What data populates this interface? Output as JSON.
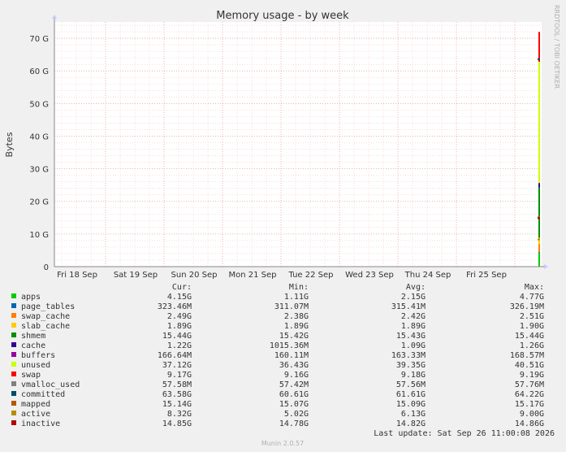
{
  "chart_data": {
    "type": "area",
    "title": "Memory usage - by week",
    "ylabel": "Bytes",
    "xlabel": "",
    "ylim": [
      0,
      75
    ],
    "yunit": "G",
    "y_ticks": [
      "0",
      "10 G",
      "20 G",
      "30 G",
      "40 G",
      "50 G",
      "60 G",
      "70 G"
    ],
    "x_ticks": [
      "Fri 18 Sep",
      "Sat 19 Sep",
      "Sun 20 Sep",
      "Mon 21 Sep",
      "Tue 22 Sep",
      "Wed 23 Sep",
      "Thu 24 Sep",
      "Fri 25 Sep"
    ],
    "grid": true,
    "columns": [
      "Cur:",
      "Min:",
      "Avg:",
      "Max:"
    ],
    "series": [
      {
        "name": "apps",
        "color": "#00cc00",
        "cur": "4.15G",
        "min": "1.11G",
        "avg": "2.15G",
        "max": "4.77G"
      },
      {
        "name": "page_tables",
        "color": "#0066b3",
        "cur": "323.46M",
        "min": "311.07M",
        "avg": "315.41M",
        "max": "326.19M"
      },
      {
        "name": "swap_cache",
        "color": "#ff8000",
        "cur": "2.49G",
        "min": "2.38G",
        "avg": "2.42G",
        "max": "2.51G"
      },
      {
        "name": "slab_cache",
        "color": "#ffcc00",
        "cur": "1.89G",
        "min": "1.89G",
        "avg": "1.89G",
        "max": "1.90G"
      },
      {
        "name": "shmem",
        "color": "#008f00",
        "cur": "15.44G",
        "min": "15.42G",
        "avg": "15.43G",
        "max": "15.44G"
      },
      {
        "name": "cache",
        "color": "#330099",
        "cur": "1.22G",
        "min": "1015.36M",
        "avg": "1.09G",
        "max": "1.26G"
      },
      {
        "name": "buffers",
        "color": "#990099",
        "cur": "166.64M",
        "min": "160.11M",
        "avg": "163.33M",
        "max": "168.57M"
      },
      {
        "name": "unused",
        "color": "#ccff00",
        "cur": "37.12G",
        "min": "36.43G",
        "avg": "39.35G",
        "max": "40.51G"
      },
      {
        "name": "swap",
        "color": "#ff0000",
        "cur": "9.17G",
        "min": "9.16G",
        "avg": "9.18G",
        "max": "9.19G"
      },
      {
        "name": "vmalloc_used",
        "color": "#808080",
        "cur": "57.58M",
        "min": "57.42M",
        "avg": "57.56M",
        "max": "57.76M"
      },
      {
        "name": "committed",
        "color": "#004d66",
        "cur": "63.58G",
        "min": "60.61G",
        "avg": "61.61G",
        "max": "64.22G"
      },
      {
        "name": "mapped",
        "color": "#b35a00",
        "cur": "15.14G",
        "min": "15.07G",
        "avg": "15.09G",
        "max": "15.17G"
      },
      {
        "name": "active",
        "color": "#b38f00",
        "cur": "8.32G",
        "min": "5.02G",
        "avg": "6.13G",
        "max": "9.00G"
      },
      {
        "name": "inactive",
        "color": "#b30000",
        "cur": "14.85G",
        "min": "14.78G",
        "avg": "14.82G",
        "max": "14.86G"
      }
    ],
    "stack_order": [
      "apps",
      "page_tables",
      "swap_cache",
      "slab_cache",
      "shmem",
      "cache",
      "buffers",
      "unused",
      "swap"
    ],
    "line_series": [
      "committed",
      "mapped",
      "active",
      "inactive"
    ],
    "last_update": "Last update: Sat Sep 26 11:00:08 2026"
  },
  "watermark": "RRDTOOL / TOBI OETIKER",
  "footer": "Munin 2.0.57"
}
